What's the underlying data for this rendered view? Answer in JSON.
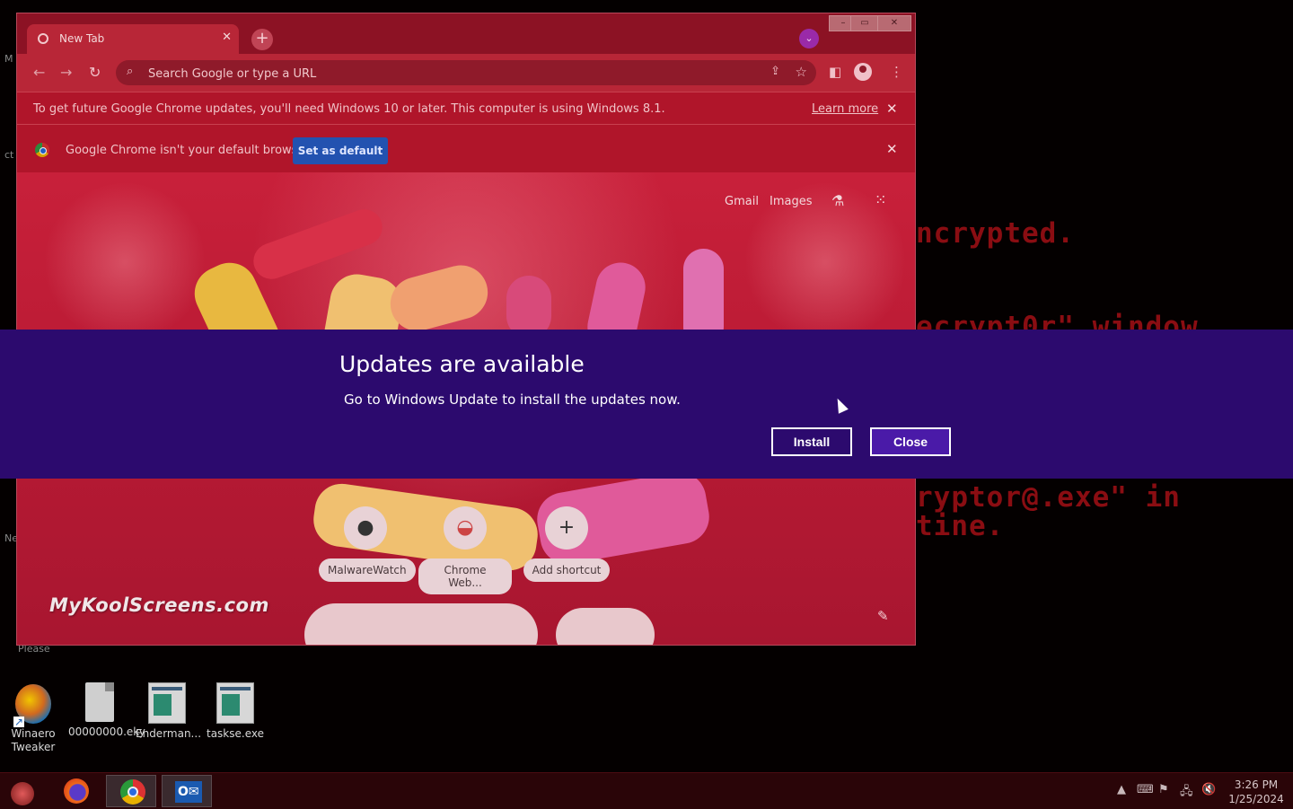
{
  "desktop": {
    "ransom_lines": [
      "ncrypted.",
      "ecrypt0r\" window",
      "ryptor@.exe\" in",
      "tine."
    ],
    "fragments": [
      "M",
      "ct",
      "Ne",
      "Please"
    ],
    "icons": [
      {
        "label": "Winaero Tweaker",
        "icon": "winaero-icon"
      },
      {
        "label": "00000000.eky",
        "icon": "document-icon"
      },
      {
        "label": "Enderman...",
        "icon": "app-window-icon"
      },
      {
        "label": "taskse.exe",
        "icon": "app-window-icon"
      }
    ]
  },
  "chrome": {
    "tab": {
      "title": "New Tab",
      "close": "✕"
    },
    "new_tab": "+",
    "tab_search": "⌄",
    "omnibox": {
      "placeholder": "Search Google or type a URL"
    },
    "infobar_1": {
      "message": "To get future Google Chrome updates, you'll need Windows 10 or later. This computer is using Windows 8.1.",
      "link": "Learn more",
      "close": "✕"
    },
    "infobar_2": {
      "message": "Google Chrome isn't your default browser",
      "button": "Set as default",
      "close": "✕"
    },
    "ntp": {
      "links": [
        "Gmail",
        "Images"
      ],
      "shortcuts": [
        {
          "label": "MalwareWatch",
          "icon": "github-icon"
        },
        {
          "label": "Chrome Web...",
          "icon": "chrome-web-store-icon"
        },
        {
          "label": "Add shortcut",
          "icon": "plus-icon"
        }
      ],
      "watermark": "MyKoolScreens.com"
    }
  },
  "update_dialog": {
    "title": "Updates are available",
    "body": "Go to Windows Update to install the updates now.",
    "install": "Install",
    "close": "Close"
  },
  "taskbar": {
    "apps": [
      "start-orb",
      "firefox",
      "chrome",
      "outlook"
    ],
    "clock": {
      "time": "3:26 PM",
      "date": "1/25/2024"
    }
  },
  "colors": {
    "banner": "#2c0a6e",
    "chrome_accent": "#b82637",
    "ransom_text": "#8a0d12"
  }
}
